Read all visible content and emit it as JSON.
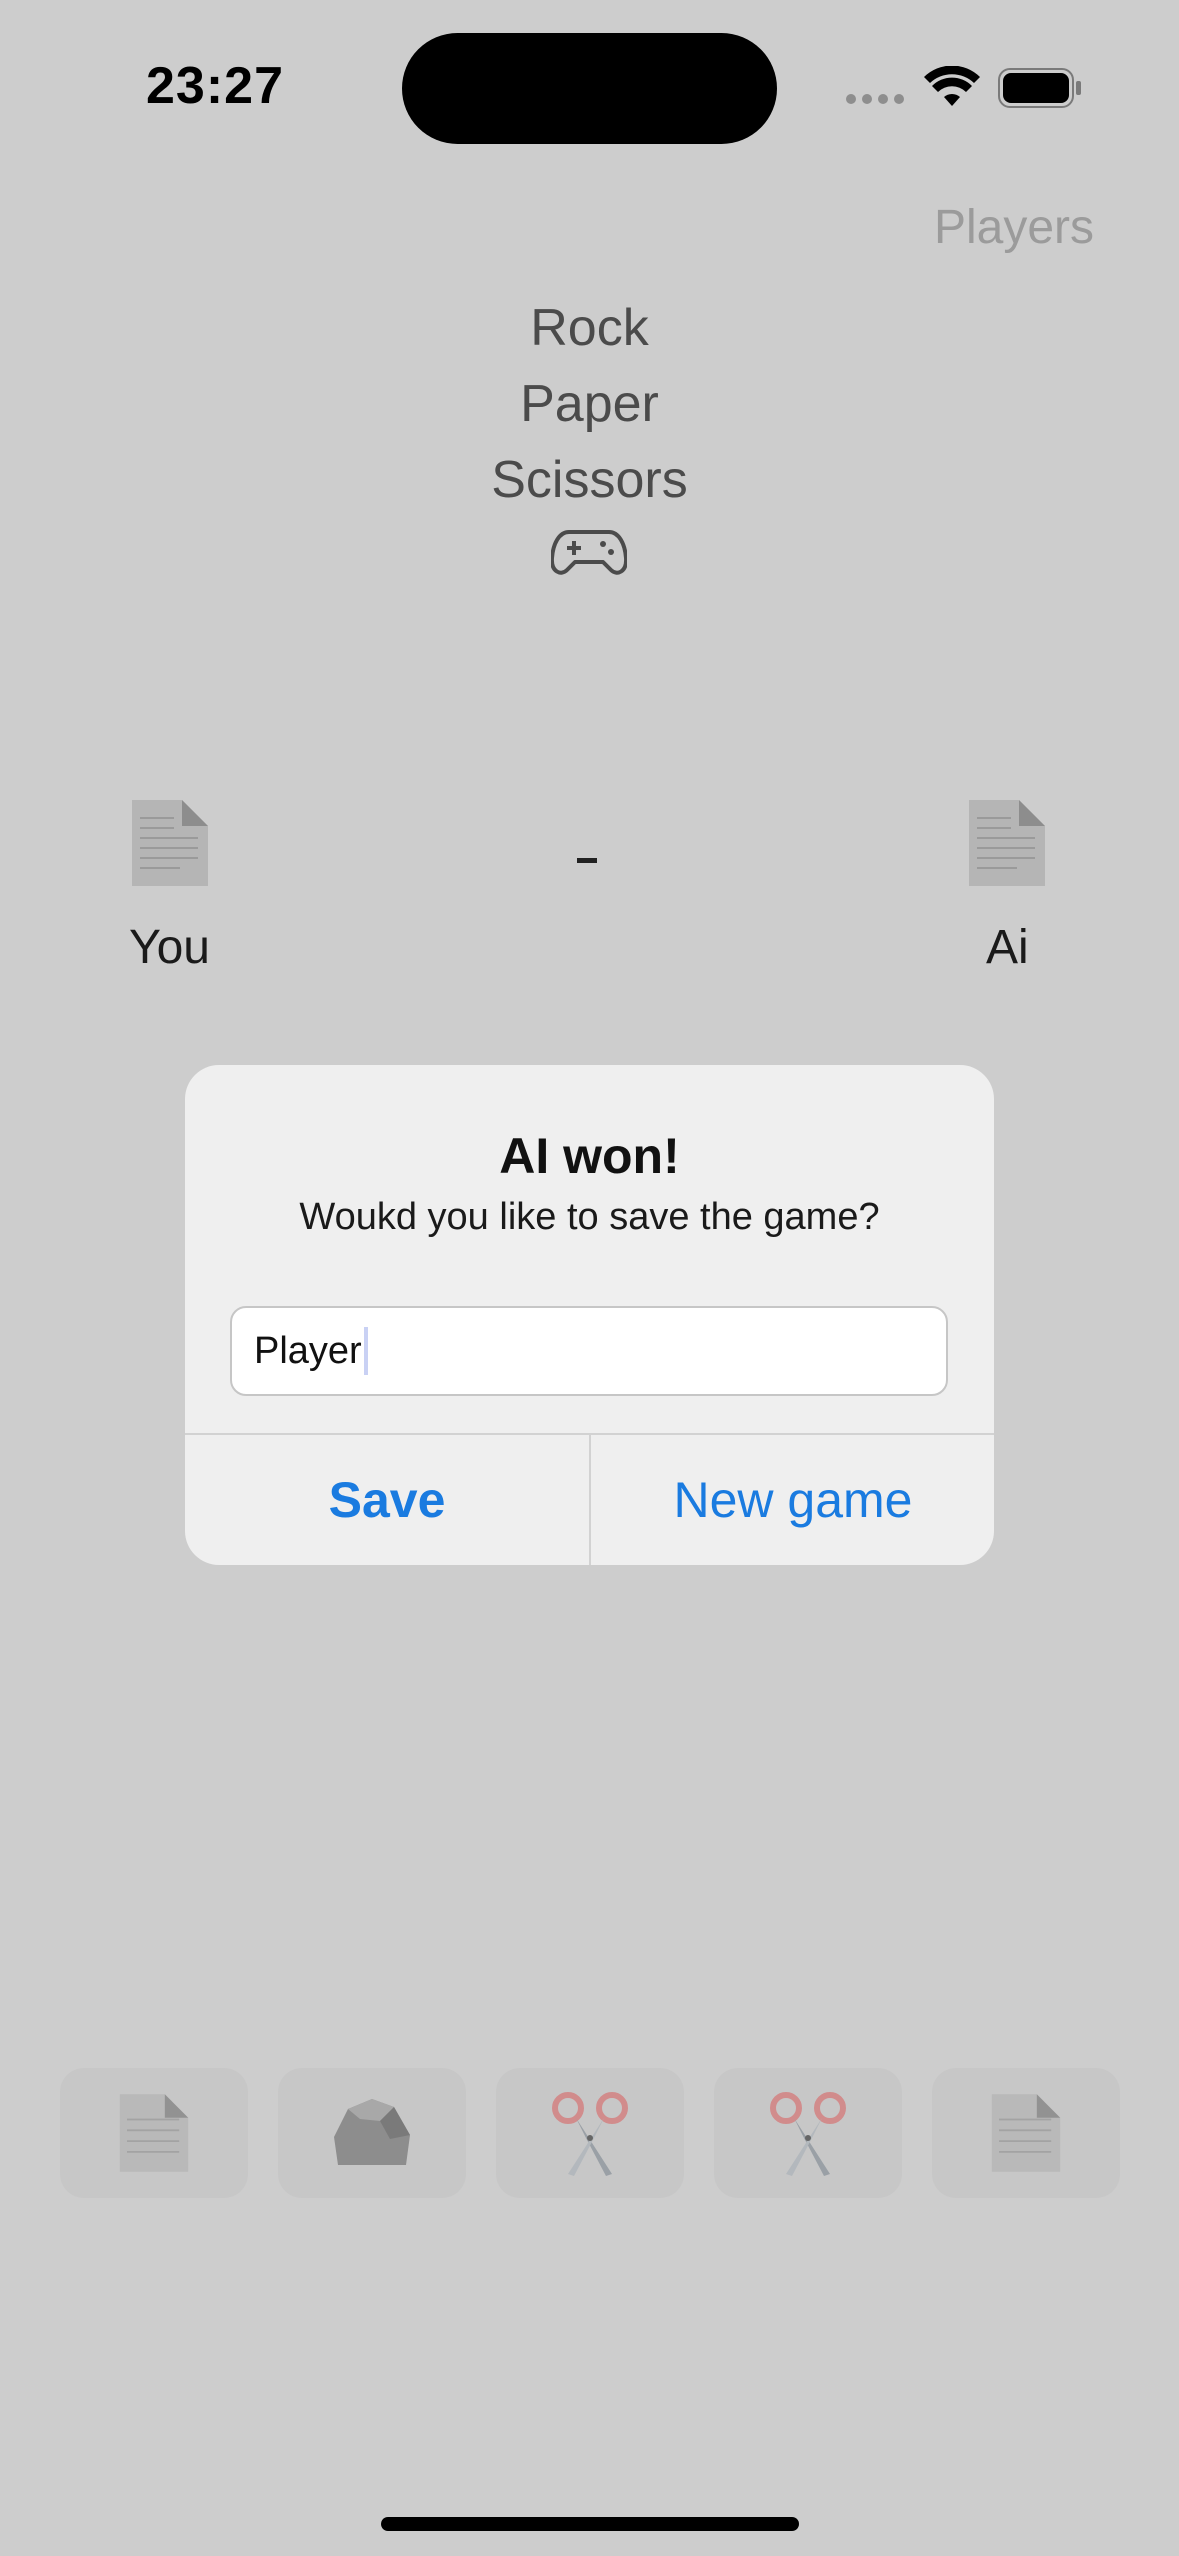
{
  "status_bar": {
    "time": "23:27"
  },
  "nav": {
    "players_label": "Players"
  },
  "title": {
    "line1": "Rock",
    "line2": "Paper",
    "line3": "Scissors"
  },
  "game": {
    "player_label": "You",
    "opponent_label": "Ai",
    "player_choice_icon": "paper-icon",
    "opponent_choice_icon": "paper-icon"
  },
  "alert": {
    "title": "AI won!",
    "message": "Woukd you like to save the game?",
    "input_value": "Player",
    "save_label": "Save",
    "new_game_label": "New game"
  },
  "choices": [
    {
      "icon": "paper-icon"
    },
    {
      "icon": "rock-icon"
    },
    {
      "icon": "scissors-icon"
    },
    {
      "icon": "scissors-icon"
    },
    {
      "icon": "paper-icon"
    }
  ],
  "colors": {
    "background": "#cdcdcd",
    "accent": "#1a7be0",
    "alert_bg": "#efefef"
  }
}
